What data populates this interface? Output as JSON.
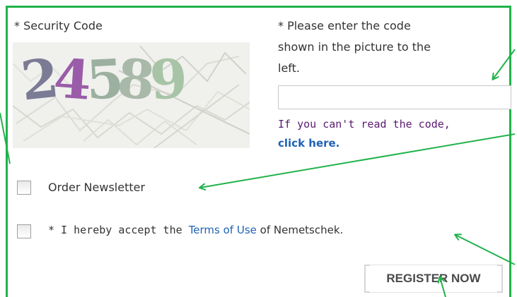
{
  "security": {
    "label": "* Security Code",
    "captcha_digits": [
      "2",
      "4",
      "5",
      "8",
      "9"
    ],
    "captcha_colors": [
      "#7b7b95",
      "#9a5ca8",
      "#9cb0a0",
      "#a9b9a9",
      "#a8c4a6"
    ],
    "prompt_lines": [
      "* Please enter the code",
      "shown in the picture to the",
      "left."
    ],
    "input_value": "",
    "hint_text": "If you can't read the code,",
    "hint_link": "click here."
  },
  "newsletter": {
    "label": "Order Newsletter",
    "checked": false
  },
  "terms": {
    "prefix": "* I hereby accept the ",
    "link": "Terms of Use",
    "suffix": " of Nemetschek.",
    "checked": false
  },
  "register_button": {
    "label": "REGISTER NOW"
  },
  "colors": {
    "frame_green": "#21b24b",
    "link_blue": "#1f62b5",
    "hint_purple": "#5a1a6e"
  }
}
